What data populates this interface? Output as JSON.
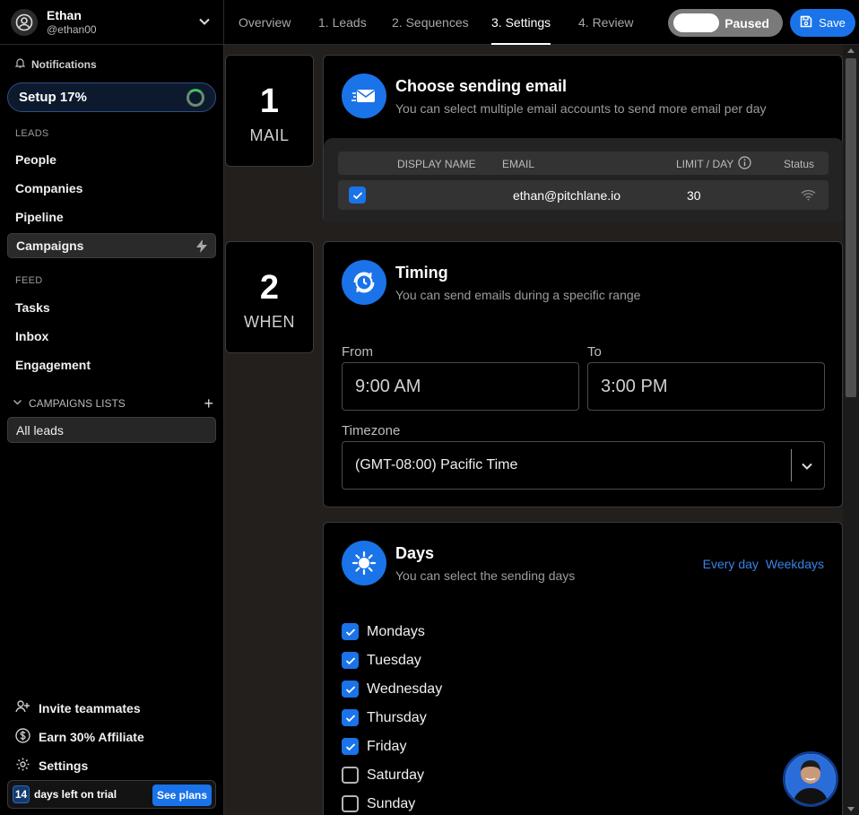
{
  "user": {
    "name": "Ethan",
    "handle": "@ethan00"
  },
  "sidebar": {
    "notifications": "Notifications",
    "setup": "Setup 17%",
    "leads_label": "LEADS",
    "leads": [
      "People",
      "Companies",
      "Pipeline",
      "Campaigns"
    ],
    "feed_label": "FEED",
    "feed": [
      "Tasks",
      "Inbox",
      "Engagement"
    ],
    "campaigns_lists": "CAMPAIGNS LISTS",
    "all_leads": "All leads",
    "bottom": [
      "Invite teammates",
      "Earn 30% Affiliate",
      "Settings"
    ],
    "trial": {
      "days": "14",
      "text": "days left on trial",
      "button": "See plans"
    }
  },
  "tabs": [
    "Overview",
    "1. Leads",
    "2. Sequences",
    "3. Settings",
    "4. Review"
  ],
  "active_tab": "3. Settings",
  "toolbar": {
    "status": "Paused",
    "save": "Save"
  },
  "steps": [
    {
      "num": "1",
      "word": "MAIL"
    },
    {
      "num": "2",
      "word": "WHEN"
    }
  ],
  "mail": {
    "title": "Choose sending email",
    "subtitle": "You can select multiple email accounts to send more email per day",
    "columns": [
      "DISPLAY NAME",
      "EMAIL",
      "LIMIT / DAY",
      "Status"
    ],
    "row": {
      "display_name": "",
      "email": "ethan@pitchlane.io",
      "limit": "30"
    }
  },
  "timing": {
    "title": "Timing",
    "subtitle": "You can send emails during a specific range",
    "from_label": "From",
    "from": "9:00 AM",
    "to_label": "To",
    "to": "3:00 PM",
    "timezone_label": "Timezone",
    "timezone": "(GMT-08:00) Pacific Time"
  },
  "days": {
    "title": "Days",
    "subtitle": "You can select the sending days",
    "links": [
      "Every day",
      "Weekdays"
    ],
    "items": [
      {
        "label": "Mondays",
        "checked": true
      },
      {
        "label": "Tuesday",
        "checked": true
      },
      {
        "label": "Wednesday",
        "checked": true
      },
      {
        "label": "Thursday",
        "checked": true
      },
      {
        "label": "Friday",
        "checked": true
      },
      {
        "label": "Saturday",
        "checked": false
      },
      {
        "label": "Sunday",
        "checked": false
      }
    ]
  },
  "colors": {
    "accent": "#1a73e8",
    "panel": "#231f1d",
    "toggle_off": "#7a7a7a"
  }
}
